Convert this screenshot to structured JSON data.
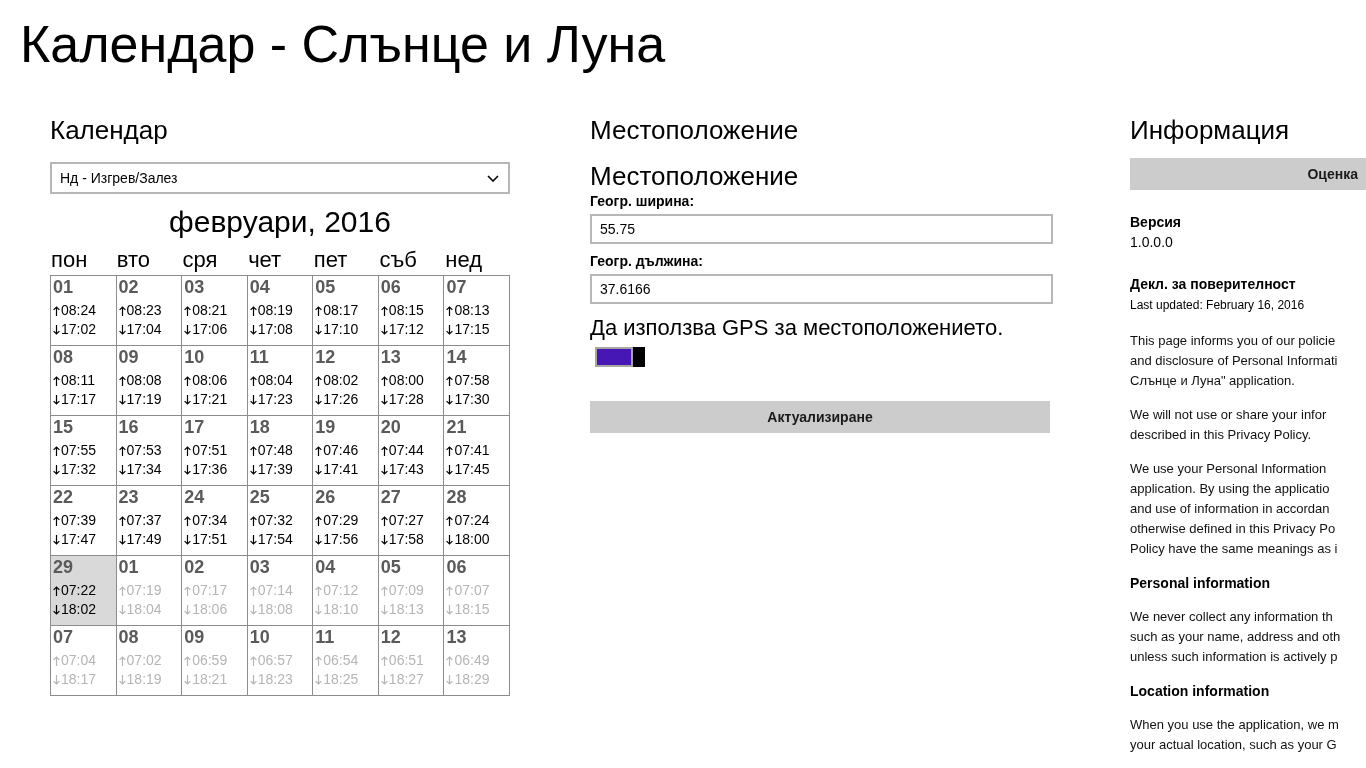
{
  "title": "Календар - Слънце и Луна",
  "calendar": {
    "heading": "Календар",
    "dropdown": {
      "value": "Нд - Изгрев/Залез"
    },
    "month": "февруари, 2016",
    "weekdays": [
      "пон",
      "вто",
      "сря",
      "чет",
      "пет",
      "съб",
      "нед"
    ],
    "weeks": [
      [
        {
          "day": "01",
          "rise": "08:24",
          "set": "17:02",
          "in_month": true,
          "selected": false
        },
        {
          "day": "02",
          "rise": "08:23",
          "set": "17:04",
          "in_month": true,
          "selected": false
        },
        {
          "day": "03",
          "rise": "08:21",
          "set": "17:06",
          "in_month": true,
          "selected": false
        },
        {
          "day": "04",
          "rise": "08:19",
          "set": "17:08",
          "in_month": true,
          "selected": false
        },
        {
          "day": "05",
          "rise": "08:17",
          "set": "17:10",
          "in_month": true,
          "selected": false
        },
        {
          "day": "06",
          "rise": "08:15",
          "set": "17:12",
          "in_month": true,
          "selected": false
        },
        {
          "day": "07",
          "rise": "08:13",
          "set": "17:15",
          "in_month": true,
          "selected": false
        }
      ],
      [
        {
          "day": "08",
          "rise": "08:11",
          "set": "17:17",
          "in_month": true,
          "selected": false
        },
        {
          "day": "09",
          "rise": "08:08",
          "set": "17:19",
          "in_month": true,
          "selected": false
        },
        {
          "day": "10",
          "rise": "08:06",
          "set": "17:21",
          "in_month": true,
          "selected": false
        },
        {
          "day": "11",
          "rise": "08:04",
          "set": "17:23",
          "in_month": true,
          "selected": false
        },
        {
          "day": "12",
          "rise": "08:02",
          "set": "17:26",
          "in_month": true,
          "selected": false
        },
        {
          "day": "13",
          "rise": "08:00",
          "set": "17:28",
          "in_month": true,
          "selected": false
        },
        {
          "day": "14",
          "rise": "07:58",
          "set": "17:30",
          "in_month": true,
          "selected": false
        }
      ],
      [
        {
          "day": "15",
          "rise": "07:55",
          "set": "17:32",
          "in_month": true,
          "selected": false
        },
        {
          "day": "16",
          "rise": "07:53",
          "set": "17:34",
          "in_month": true,
          "selected": false
        },
        {
          "day": "17",
          "rise": "07:51",
          "set": "17:36",
          "in_month": true,
          "selected": false
        },
        {
          "day": "18",
          "rise": "07:48",
          "set": "17:39",
          "in_month": true,
          "selected": false
        },
        {
          "day": "19",
          "rise": "07:46",
          "set": "17:41",
          "in_month": true,
          "selected": false
        },
        {
          "day": "20",
          "rise": "07:44",
          "set": "17:43",
          "in_month": true,
          "selected": false
        },
        {
          "day": "21",
          "rise": "07:41",
          "set": "17:45",
          "in_month": true,
          "selected": false
        }
      ],
      [
        {
          "day": "22",
          "rise": "07:39",
          "set": "17:47",
          "in_month": true,
          "selected": false
        },
        {
          "day": "23",
          "rise": "07:37",
          "set": "17:49",
          "in_month": true,
          "selected": false
        },
        {
          "day": "24",
          "rise": "07:34",
          "set": "17:51",
          "in_month": true,
          "selected": false
        },
        {
          "day": "25",
          "rise": "07:32",
          "set": "17:54",
          "in_month": true,
          "selected": false
        },
        {
          "day": "26",
          "rise": "07:29",
          "set": "17:56",
          "in_month": true,
          "selected": false
        },
        {
          "day": "27",
          "rise": "07:27",
          "set": "17:58",
          "in_month": true,
          "selected": false
        },
        {
          "day": "28",
          "rise": "07:24",
          "set": "18:00",
          "in_month": true,
          "selected": false
        }
      ],
      [
        {
          "day": "29",
          "rise": "07:22",
          "set": "18:02",
          "in_month": true,
          "selected": true
        },
        {
          "day": "01",
          "rise": "07:19",
          "set": "18:04",
          "in_month": false,
          "selected": false
        },
        {
          "day": "02",
          "rise": "07:17",
          "set": "18:06",
          "in_month": false,
          "selected": false
        },
        {
          "day": "03",
          "rise": "07:14",
          "set": "18:08",
          "in_month": false,
          "selected": false
        },
        {
          "day": "04",
          "rise": "07:12",
          "set": "18:10",
          "in_month": false,
          "selected": false
        },
        {
          "day": "05",
          "rise": "07:09",
          "set": "18:13",
          "in_month": false,
          "selected": false
        },
        {
          "day": "06",
          "rise": "07:07",
          "set": "18:15",
          "in_month": false,
          "selected": false
        }
      ],
      [
        {
          "day": "07",
          "rise": "07:04",
          "set": "18:17",
          "in_month": false,
          "selected": false
        },
        {
          "day": "08",
          "rise": "07:02",
          "set": "18:19",
          "in_month": false,
          "selected": false
        },
        {
          "day": "09",
          "rise": "06:59",
          "set": "18:21",
          "in_month": false,
          "selected": false
        },
        {
          "day": "10",
          "rise": "06:57",
          "set": "18:23",
          "in_month": false,
          "selected": false
        },
        {
          "day": "11",
          "rise": "06:54",
          "set": "18:25",
          "in_month": false,
          "selected": false
        },
        {
          "day": "12",
          "rise": "06:51",
          "set": "18:27",
          "in_month": false,
          "selected": false
        },
        {
          "day": "13",
          "rise": "06:49",
          "set": "18:29",
          "in_month": false,
          "selected": false
        }
      ]
    ]
  },
  "location": {
    "heading": "Местоположение",
    "subheading": "Местоположение",
    "fields": [
      {
        "label": "Геогр. ширина:",
        "value": "55.75"
      },
      {
        "label": "Геогр. дължина:",
        "value": "37.6166"
      }
    ],
    "gps": {
      "label": "Да използва GPS за местоположението.",
      "on": true
    },
    "button": "Актуализиране"
  },
  "info": {
    "heading": "Информация",
    "rate_button": "Оценка",
    "version": {
      "label": "Версия",
      "value": "1.0.0.0"
    },
    "privacy": {
      "label": "Декл. за поверителност",
      "updated": "Last updated: February 16, 2016",
      "blocks": [
        {
          "kind": "paragraph",
          "lines": [
            "This page informs you of our policie",
            "and disclosure of Personal Informati",
            "Слънце и Луна\" application."
          ]
        },
        {
          "kind": "paragraph",
          "lines": [
            "We will not use or share your infor",
            "described in this Privacy Policy."
          ]
        },
        {
          "kind": "paragraph",
          "lines": [
            "We use your Personal Information",
            "application. By using the applicatio",
            "and use of information in accordan",
            "otherwise defined in this Privacy Po",
            "Policy have the same meanings as i"
          ]
        },
        {
          "kind": "heading",
          "text": "Personal information"
        },
        {
          "kind": "paragraph",
          "lines": [
            "We never collect any information th",
            "such as your name, address and oth",
            "unless such information is actively p"
          ]
        },
        {
          "kind": "heading",
          "text": "Location information"
        },
        {
          "kind": "paragraph",
          "lines": [
            "When you use the application, we m",
            "your actual location, such as your G"
          ]
        }
      ]
    }
  }
}
